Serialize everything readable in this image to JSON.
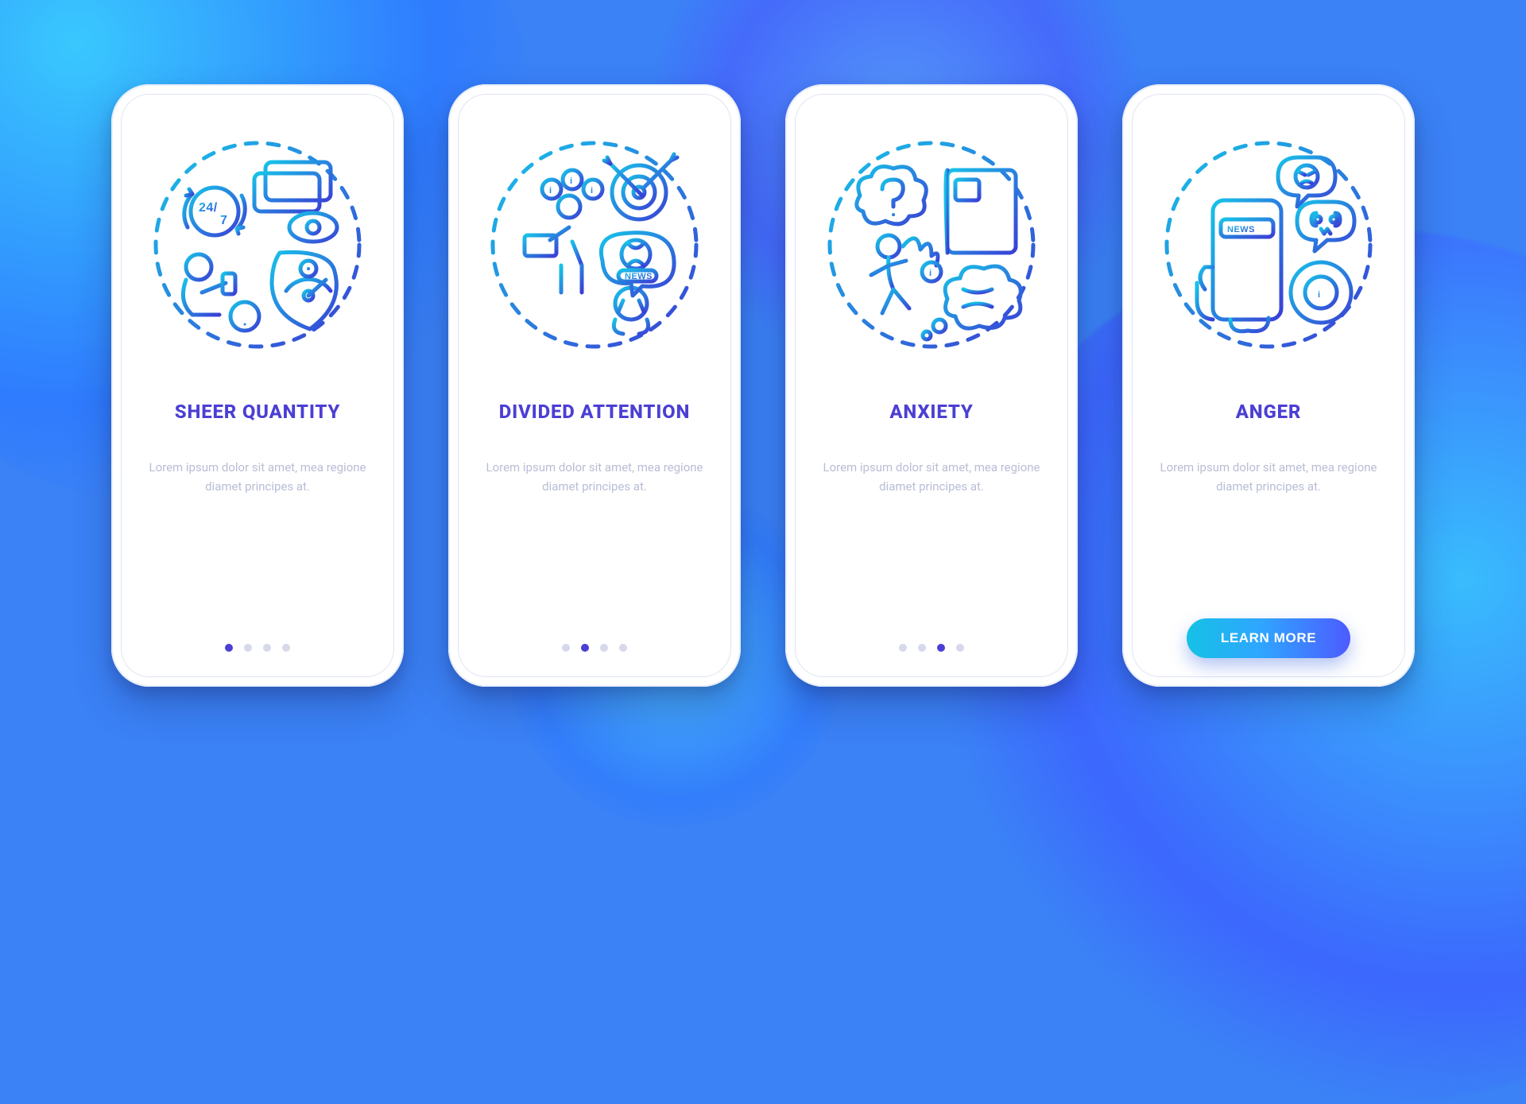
{
  "screens": [
    {
      "title": "SHEER QUANTITY",
      "desc": "Lorem ipsum dolor sit amet, mea regione diamet principes at.",
      "activeDot": 0,
      "icon_labels": {
        "badge24": "24/",
        "badge7": "7"
      }
    },
    {
      "title": "DIVIDED ATTENTION",
      "desc": "Lorem ipsum dolor sit amet, mea regione diamet principes at.",
      "activeDot": 1,
      "icon_labels": {
        "news": "NEWS"
      }
    },
    {
      "title": "ANXIETY",
      "desc": "Lorem ipsum dolor sit amet, mea regione diamet principes at.",
      "activeDot": 2,
      "icon_labels": {}
    },
    {
      "title": "ANGER",
      "desc": "Lorem ipsum dolor sit amet, mea regione diamet principes at.",
      "activeDot": 3,
      "icon_labels": {
        "news": "NEWS"
      },
      "cta": "LEARN MORE"
    }
  ],
  "dotCount": 4,
  "colors": {
    "gradient_from": "#17c3e8",
    "gradient_to": "#3a3fd6",
    "title": "#4b3fd4",
    "desc": "#b9bdd6",
    "dot_inactive": "#d6d9ea",
    "dot_active": "#4b3fd4"
  }
}
